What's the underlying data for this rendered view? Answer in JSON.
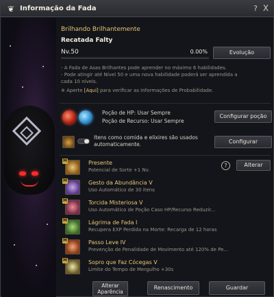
{
  "window": {
    "title": "Informação da Fada",
    "help_label": "?",
    "close_label": "X"
  },
  "fairy": {
    "name": "Brilhando Brilhantemente",
    "species": "Recatada Falty",
    "level": "Nv.50",
    "progress_text": "0.00%",
    "progress": 0.0
  },
  "buttons": {
    "evolution": "Evolução",
    "configure_potion": "Configurar poção",
    "configure": "Configurar",
    "alter": "Alterar",
    "alter_appearance_line1": "Alterar",
    "alter_appearance_line2": "Aparência",
    "rebirth": "Renascimento",
    "save": "Guardar"
  },
  "description": {
    "line1": "- A Fada de Asas Brilhantes pode aprender no máximo 6 habilidades.",
    "line2": "- Pode atingir até Nível 50 e uma nova habilidade poderá ser aprendida a",
    "line3": "cada 10 níveis.",
    "line4_pre": "※ Aperte ",
    "line4_link": "[Aqui]",
    "line4_post": " para verificar as Informações de Probabilidade."
  },
  "potions": {
    "hp": "Poção de HP: Usar Sempre",
    "resource": "Poção de Recurso: Usar Sempre"
  },
  "food": {
    "text": "Itens como comida e elixires são usados automaticamente.",
    "toggle_on": false
  },
  "skills": [
    {
      "badge": "M",
      "name": "Presente",
      "desc": "Potencial de Sorte +1 Nv.",
      "icon": "gift-icon"
    },
    {
      "badge": "M",
      "name": "Gesto da Abundância V",
      "desc": "Uso Automático de 30 itens",
      "icon": "wand-icon"
    },
    {
      "badge": "M",
      "name": "Torcida Misteriosa V",
      "desc": "Uso Automático de Poção Caso HP/Recurso Reduzir...",
      "icon": "cheer-icon"
    },
    {
      "badge": "M",
      "name": "Lágrima de Fada I",
      "desc": "Recupera EXP Perdida na Morte: Recarga de 12 horas",
      "icon": "tear-icon"
    },
    {
      "badge": "M",
      "name": "Passo Leve IV",
      "desc": "Prevenção de Penalidade de Movimento até 120% de Pe...",
      "icon": "step-icon"
    },
    {
      "badge": "M",
      "name": "Sopro que Faz Cócegas V",
      "desc": "Limite do Tempo de Mergulho +30s",
      "icon": "breath-icon"
    }
  ],
  "colors": {
    "accent_gold": "#e8c878",
    "window_bg": "#14151a"
  }
}
